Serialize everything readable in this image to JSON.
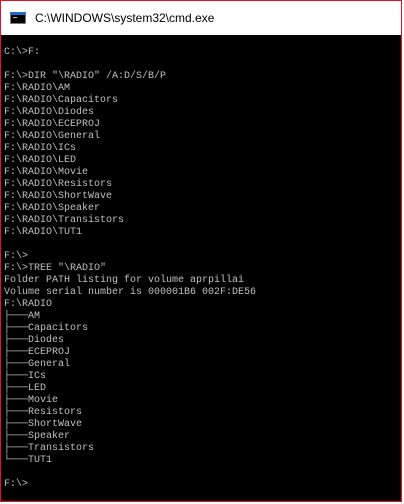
{
  "window": {
    "title": "C:\\WINDOWS\\system32\\cmd.exe",
    "border_color": "#e81123",
    "console_background": "#000000",
    "console_text_color": "#c0c0c0"
  },
  "console": {
    "lines": [
      "",
      "C:\\>F:",
      "",
      "F:\\>DIR \"\\RADIO\" /A:D/S/B/P",
      "F:\\RADIO\\AM",
      "F:\\RADIO\\Capacitors",
      "F:\\RADIO\\Diodes",
      "F:\\RADIO\\ECEPROJ",
      "F:\\RADIO\\General",
      "F:\\RADIO\\ICs",
      "F:\\RADIO\\LED",
      "F:\\RADIO\\Movie",
      "F:\\RADIO\\Resistors",
      "F:\\RADIO\\ShortWave",
      "F:\\RADIO\\Speaker",
      "F:\\RADIO\\Transistors",
      "F:\\RADIO\\TUT1",
      "",
      "F:\\>",
      "F:\\>TREE \"\\RADIO\"",
      "Folder PATH listing for volume aprpillai",
      "Volume serial number is 000001B6 002F:DE56",
      "F:\\RADIO",
      "├───AM",
      "├───Capacitors",
      "├───Diodes",
      "├───ECEPROJ",
      "├───General",
      "├───ICs",
      "├───LED",
      "├───Movie",
      "├───Resistors",
      "├───ShortWave",
      "├───Speaker",
      "├───Transistors",
      "└───TUT1",
      "",
      "F:\\>"
    ]
  }
}
